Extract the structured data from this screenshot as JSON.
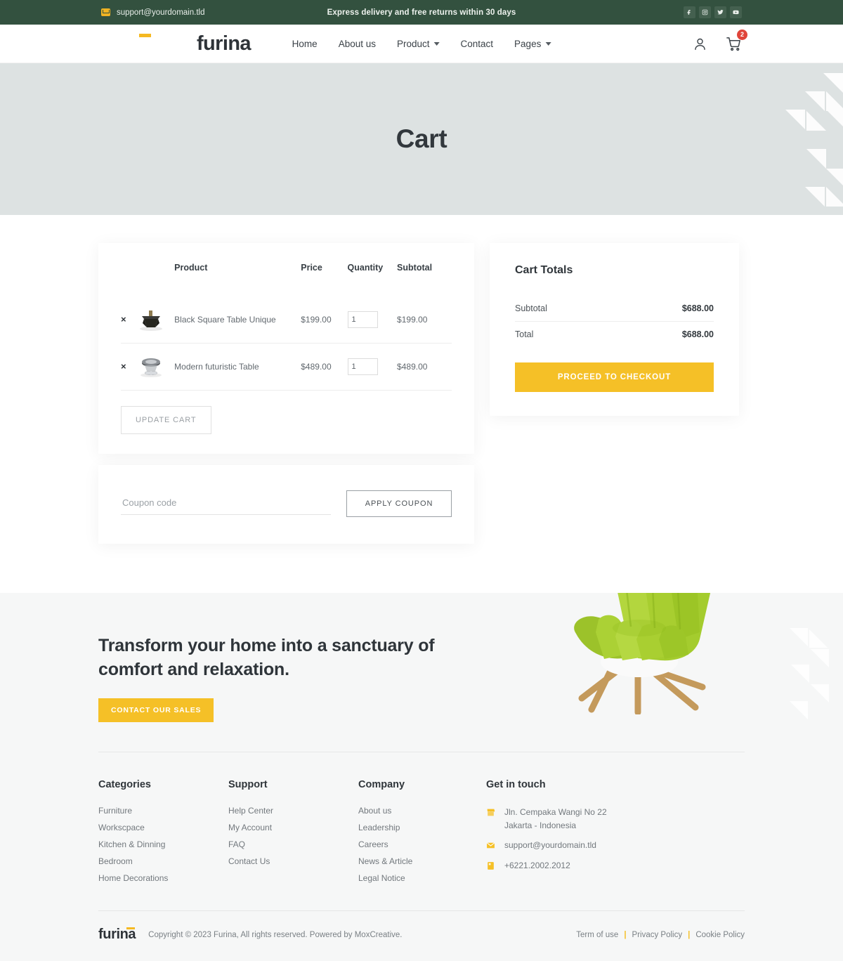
{
  "topbar": {
    "email": "support@yourdomain.tld",
    "email_icon": "envelope-icon",
    "promo": "Express delivery and free returns within 30 days",
    "socials": [
      {
        "name": "facebook-icon",
        "label": "Facebook"
      },
      {
        "name": "instagram-icon",
        "label": "Instagram"
      },
      {
        "name": "twitter-icon",
        "label": "Twitter"
      },
      {
        "name": "youtube-icon",
        "label": "YouTube"
      }
    ]
  },
  "header": {
    "logo": "furina",
    "nav": [
      {
        "label": "Home",
        "dropdown": false
      },
      {
        "label": "About us",
        "dropdown": false
      },
      {
        "label": "Product",
        "dropdown": true
      },
      {
        "label": "Contact",
        "dropdown": false
      },
      {
        "label": "Pages",
        "dropdown": true
      }
    ],
    "account_icon": "user-icon",
    "cart_icon": "shopping-cart-icon",
    "cart_count": "2"
  },
  "hero": {
    "title": "Cart"
  },
  "cart": {
    "columns": {
      "product": "Product",
      "price": "Price",
      "quantity": "Quantity",
      "subtotal": "Subtotal"
    },
    "items": [
      {
        "name": "Black Square Table Unique",
        "price": "$199.00",
        "quantity": "1",
        "subtotal": "$199.00",
        "remove": "×",
        "thumb": "black-square-table-thumbnail"
      },
      {
        "name": "Modern futuristic Table",
        "price": "$489.00",
        "quantity": "1",
        "subtotal": "$489.00",
        "remove": "×",
        "thumb": "modern-futuristic-table-thumbnail"
      }
    ],
    "update_cart_label": "UPDATE CART",
    "coupon_placeholder": "Coupon code",
    "coupon_value": "",
    "apply_coupon_label": "APPLY COUPON"
  },
  "totals": {
    "title": "Cart Totals",
    "rows": [
      {
        "label": "Subtotal",
        "value": "$688.00"
      },
      {
        "label": "Total",
        "value": "$688.00"
      }
    ],
    "checkout_label": "PROCEED TO CHECKOUT"
  },
  "cta": {
    "heading": "Transform your home into a sanctuary of comfort and relaxation.",
    "button": "CONTACT OUR SALES",
    "image": "green-lounge-chair"
  },
  "footer": {
    "columns": [
      {
        "title": "Categories",
        "links": [
          "Furniture",
          "Workscpace",
          "Kitchen & Dinning",
          "Bedroom",
          "Home Decorations"
        ]
      },
      {
        "title": "Support",
        "links": [
          "Help Center",
          "My Account",
          "FAQ",
          "Contact Us"
        ]
      },
      {
        "title": "Company",
        "links": [
          "About us",
          "Leadership",
          "Careers",
          "News & Article",
          "Legal Notice"
        ]
      }
    ],
    "contact": {
      "title": "Get in touch",
      "address_line1": "Jln. Cempaka Wangi No 22",
      "address_line2": "Jakarta - Indonesia",
      "email": "support@yourdomain.tld",
      "phone": "+6221.2002.2012",
      "address_icon": "store-icon",
      "email_icon": "envelope-icon",
      "phone_icon": "phone-icon"
    },
    "logo": "furina",
    "copyright": "Copyright © 2023 Furina, All rights reserved. Powered by MoxCreative.",
    "legal": [
      "Term of use",
      "Privacy Policy",
      "Cookie Policy"
    ],
    "separator": "|"
  },
  "colors": {
    "topbar_green": "#33513f",
    "accent_yellow": "#f5c027",
    "hero_gray": "#dde2e2",
    "footer_gray": "#f6f7f7",
    "badge_red": "#e0453a",
    "chair_green": "#9ccb2a"
  }
}
